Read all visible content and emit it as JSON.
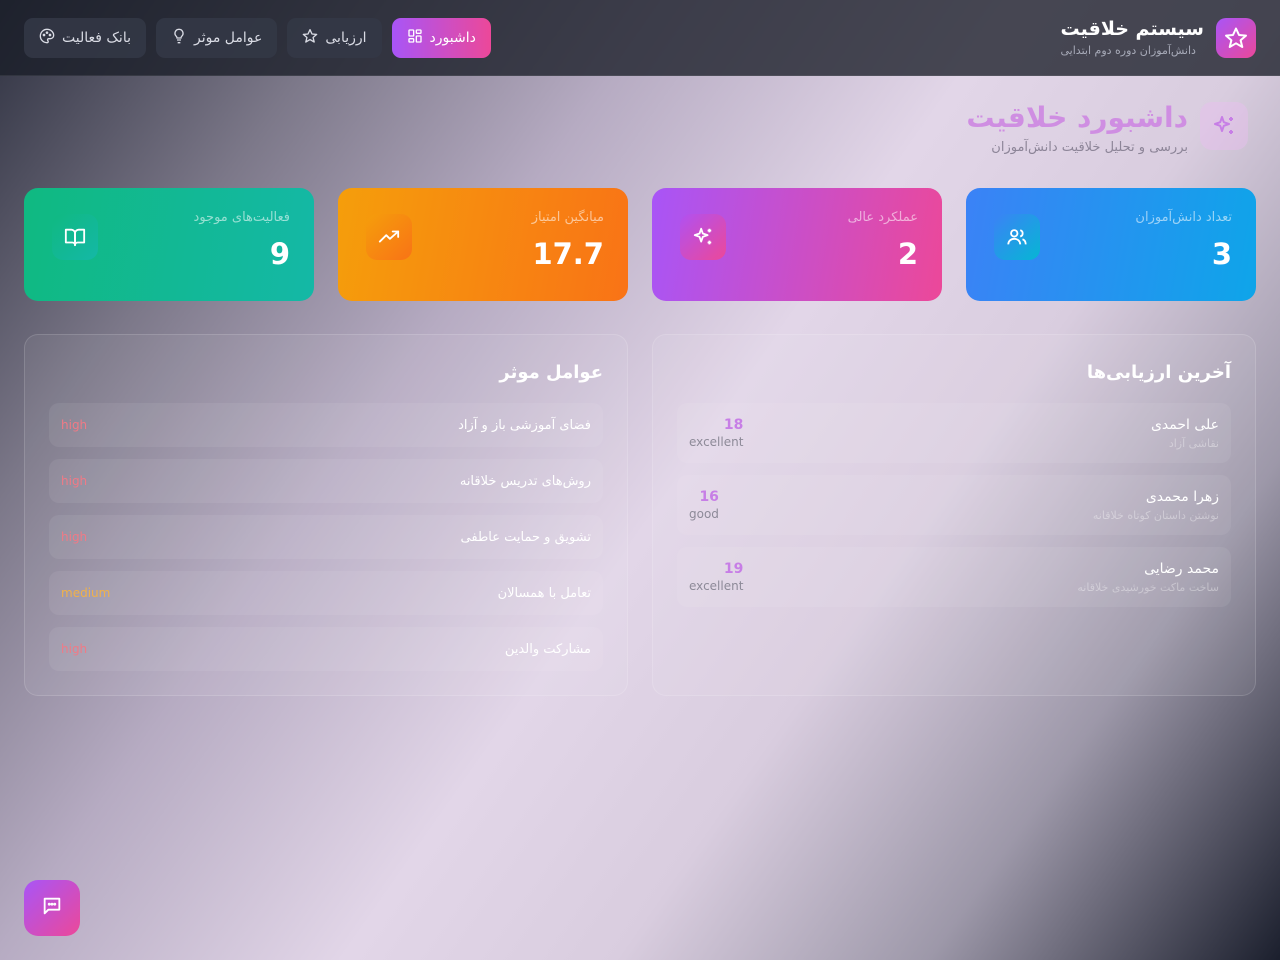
{
  "header": {
    "title": "سیستم خلاقیت",
    "subtitle": "دانش‌آموزان دوره دوم ابتدایی",
    "nav": [
      {
        "label": "داشبورد",
        "icon": "dashboard-icon",
        "active": true
      },
      {
        "label": "ارزیابی",
        "icon": "star-icon",
        "active": false
      },
      {
        "label": "عوامل موثر",
        "icon": "lightbulb-icon",
        "active": false
      },
      {
        "label": "بانک فعالیت",
        "icon": "palette-icon",
        "active": false
      }
    ]
  },
  "page": {
    "title": "داشبورد خلاقیت",
    "subtitle": "بررسی و تحلیل خلاقیت دانش‌آموزان"
  },
  "stats": [
    {
      "label": "تعداد دانش‌آموزان",
      "value": "3",
      "icon": "users-icon",
      "color": "#3b82f6"
    },
    {
      "label": "عملکرد عالی",
      "value": "2",
      "icon": "sparkles-icon",
      "color": "#a855f7"
    },
    {
      "label": "میانگین امتیاز",
      "value": "17.7",
      "icon": "trending-up-icon",
      "color": "#f59e0b"
    },
    {
      "label": "فعالیت‌های موجود",
      "value": "9",
      "icon": "book-open-icon",
      "color": "#10b981"
    }
  ],
  "evaluations": {
    "title": "آخرین ارزیابی‌ها",
    "items": [
      {
        "name": "علی احمدی",
        "activity": "نقاشی آزاد",
        "score": "18",
        "level": "excellent"
      },
      {
        "name": "زهرا محمدی",
        "activity": "نوشتن داستان کوتاه خلاقانه",
        "score": "16",
        "level": "good"
      },
      {
        "name": "محمد رضایی",
        "activity": "ساخت ماکت خورشیدی خلاقانه",
        "score": "19",
        "level": "excellent"
      }
    ]
  },
  "factors": {
    "title": "عوامل موثر",
    "items": [
      {
        "name": "فضای آموزشی باز و آزاد",
        "level": "high"
      },
      {
        "name": "روش‌های تدریس خلاقانه",
        "level": "high"
      },
      {
        "name": "تشویق و حمایت عاطفی",
        "level": "high"
      },
      {
        "name": "تعامل با همسالان",
        "level": "medium"
      },
      {
        "name": "مشارکت والدین",
        "level": "high"
      }
    ]
  },
  "chat": {
    "icon": "chat-icon"
  }
}
